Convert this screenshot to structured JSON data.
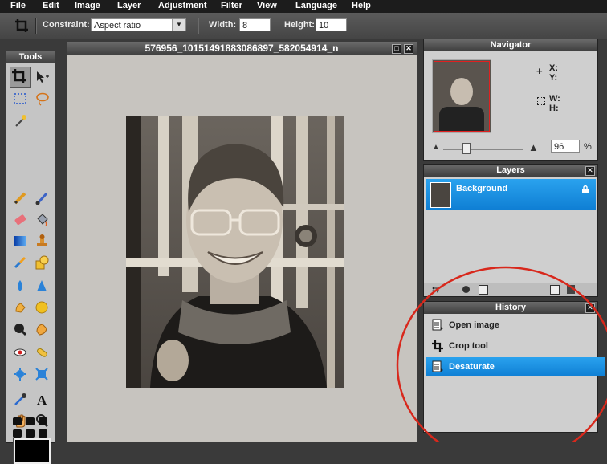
{
  "menu": [
    "File",
    "Edit",
    "Image",
    "Layer",
    "Adjustment",
    "Filter",
    "View",
    "Language",
    "Help"
  ],
  "options": {
    "constraint_label": "Constraint:",
    "constraint_value": "Aspect ratio",
    "width_label": "Width:",
    "width_value": "8",
    "height_label": "Height:",
    "height_value": "10"
  },
  "tools_title": "Tools",
  "canvas": {
    "title": "576956_10151491883086897_582054914_n"
  },
  "navigator": {
    "title": "Navigator",
    "x_label": "X:",
    "y_label": "Y:",
    "w_label": "W:",
    "h_label": "H:",
    "zoom_value": "96",
    "zoom_unit": "%"
  },
  "layers": {
    "title": "Layers",
    "items": [
      {
        "name": "Background"
      }
    ]
  },
  "history": {
    "title": "History",
    "items": [
      {
        "label": "Open image"
      },
      {
        "label": "Crop tool"
      },
      {
        "label": "Desaturate"
      }
    ]
  },
  "colors": {
    "accent": "#1a8fe0",
    "annotation": "#d8281c"
  }
}
